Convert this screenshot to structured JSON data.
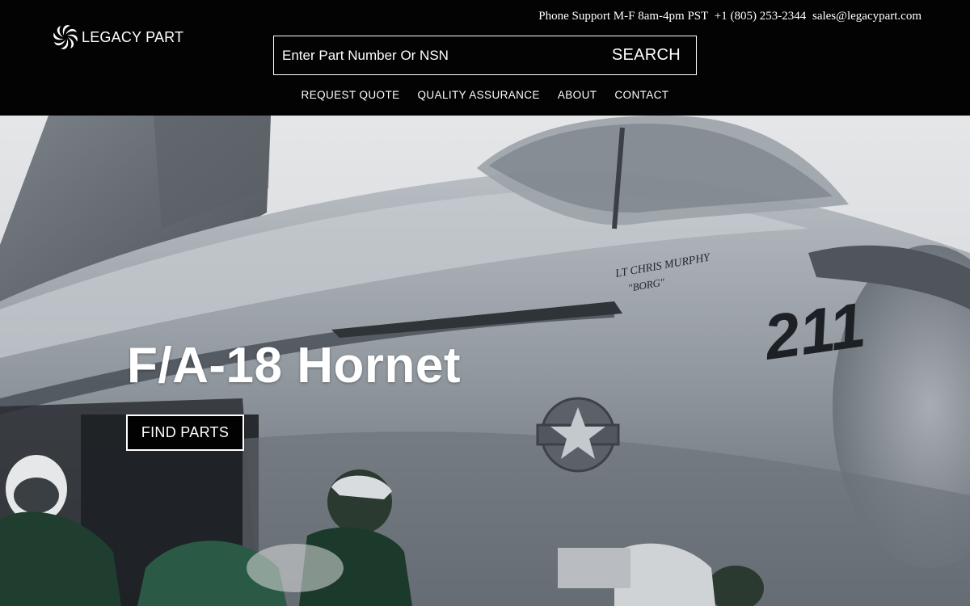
{
  "header": {
    "support": {
      "hours": "Phone Support M-F 8am-4pm PST",
      "phone": "+1 (805) 253-2344",
      "email": "sales@legacypart.com"
    },
    "logo_text": "LEGACY PART",
    "search": {
      "placeholder": "Enter Part Number Or NSN",
      "button_label": "SEARCH"
    },
    "nav": [
      "REQUEST QUOTE",
      "QUALITY ASSURANCE",
      "ABOUT",
      "CONTACT"
    ]
  },
  "hero": {
    "title": "F/A-18 Hornet",
    "cta_label": "FIND PARTS",
    "fuselage_texts": {
      "pilot_name": "LT CHRIS MURPHY",
      "callsign": "\"BORG\"",
      "modex": "211"
    }
  },
  "colors": {
    "header_bg": "#030303",
    "text": "#ffffff"
  }
}
